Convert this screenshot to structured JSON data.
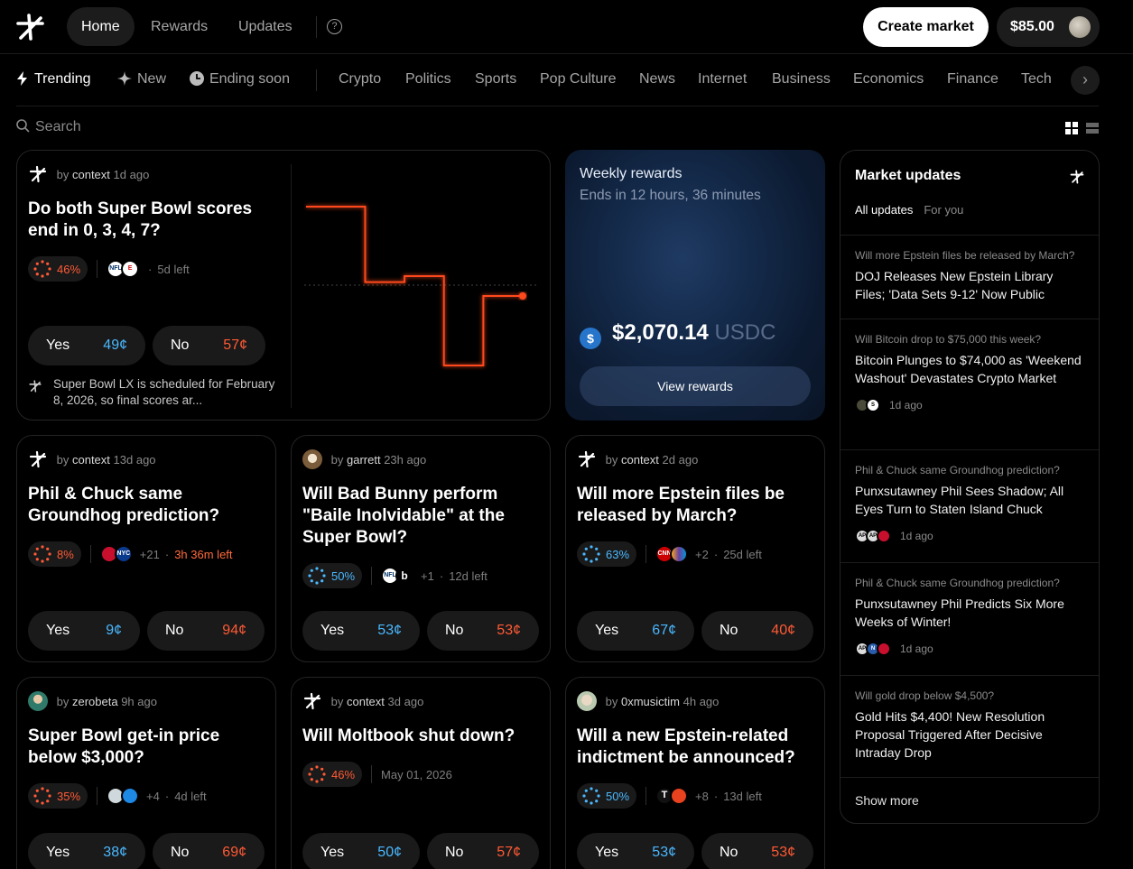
{
  "nav": {
    "home": "Home",
    "rewards": "Rewards",
    "updates": "Updates",
    "help": "?",
    "create": "Create market",
    "balance": "$85.00"
  },
  "categories": {
    "trending": "Trending",
    "new": "New",
    "ending": "Ending soon",
    "items": [
      "Crypto",
      "Politics",
      "Sports",
      "Pop Culture",
      "News",
      "Internet",
      "Business",
      "Economics",
      "Finance",
      "Tech"
    ]
  },
  "search": {
    "placeholder": "Search"
  },
  "markets": [
    {
      "by": "by",
      "author": "context",
      "ago": "1d ago",
      "title": "Do both Super Bowl scores end in 0, 3, 4, 7?",
      "prob": "46%",
      "left": "5d left",
      "yes": "Yes",
      "yes_price": "49¢",
      "no": "No",
      "no_price": "57¢",
      "note": "Super Bowl LX is scheduled for February 8, 2026, so final scores ar..."
    },
    {
      "by": "by",
      "author": "context",
      "ago": "13d ago",
      "title": "Phil & Chuck same Groundhog prediction?",
      "prob": "8%",
      "more": "+21",
      "left": "3h 36m left",
      "yes": "Yes",
      "yes_price": "9¢",
      "no": "No",
      "no_price": "94¢"
    },
    {
      "by": "by",
      "author": "garrett",
      "ago": "23h ago",
      "title": "Will Bad Bunny perform \"Baile Inolvidable\" at the Super Bowl?",
      "prob": "50%",
      "more": "+1",
      "left": "12d left",
      "yes": "Yes",
      "yes_price": "53¢",
      "no": "No",
      "no_price": "53¢"
    },
    {
      "by": "by",
      "author": "context",
      "ago": "2d ago",
      "title": "Will more Epstein files be released by March?",
      "prob": "63%",
      "more": "+2",
      "left": "25d left",
      "yes": "Yes",
      "yes_price": "67¢",
      "no": "No",
      "no_price": "40¢"
    },
    {
      "by": "by",
      "author": "zerobeta",
      "ago": "9h ago",
      "title": "Super Bowl get-in price below $3,000?",
      "prob": "35%",
      "more": "+4",
      "left": "4d left",
      "yes": "Yes",
      "yes_price": "38¢",
      "no": "No",
      "no_price": "69¢"
    },
    {
      "by": "by",
      "author": "context",
      "ago": "3d ago",
      "title": "Will Moltbook shut down?",
      "prob": "46%",
      "left": "May 01, 2026",
      "yes": "Yes",
      "yes_price": "50¢",
      "no": "No",
      "no_price": "57¢"
    },
    {
      "by": "by",
      "author": "0xmusictim",
      "ago": "4h ago",
      "title": "Will a new Epstein-related indictment be announced?",
      "prob": "50%",
      "more": "+8",
      "left": "13d left",
      "yes": "Yes",
      "yes_price": "53¢",
      "no": "No",
      "no_price": "53¢"
    }
  ],
  "chart_data": {
    "type": "line",
    "series": [
      {
        "values": [
          0.9,
          0.9,
          0.9,
          0.52,
          0.52,
          0.55,
          0.55,
          0.1,
          0.1,
          0.45,
          0.45,
          0.45
        ]
      }
    ],
    "x": [
      0,
      1,
      2,
      3,
      4,
      5,
      6,
      7,
      8,
      9,
      10,
      11
    ],
    "color": "#ff4a1f",
    "ylim": [
      0,
      1
    ],
    "grid": "dotted midline"
  },
  "rewards": {
    "title": "Weekly rewards",
    "ends": "Ends in 12 hours, 36 minutes",
    "amount": "$2,070.14",
    "currency": "USDC",
    "button": "View rewards"
  },
  "updates": {
    "title": "Market updates",
    "tab_all": "All updates",
    "tab_you": "For you",
    "items": [
      {
        "q": "Will more Epstein files be released by March?",
        "h": "DOJ Releases New Epstein Library Files; 'Data Sets 9-12' Now Public"
      },
      {
        "q": "Will Bitcoin drop to $75,000 this week?",
        "h": "Bitcoin Plunges to $74,000 as 'Weekend Washout' Devastates Crypto Market",
        "ago": "1d ago"
      },
      {
        "q": "Phil & Chuck same Groundhog prediction?",
        "h": "Punxsutawney Phil Sees Shadow; All Eyes Turn to Staten Island Chuck",
        "ago": "1d ago"
      },
      {
        "q": "Phil & Chuck same Groundhog prediction?",
        "h": "Punxsutawney Phil Predicts Six More Weeks of Winter!",
        "ago": "1d ago"
      },
      {
        "q": "Will gold drop below $4,500?",
        "h": "Gold Hits $4,400! New Resolution Proposal Triggered After Decisive Intraday Drop"
      }
    ],
    "show_more": "Show more"
  },
  "colors": {
    "accent_red": "#ff5a35",
    "accent_blue": "#4ab8ff",
    "background": "#000000"
  }
}
